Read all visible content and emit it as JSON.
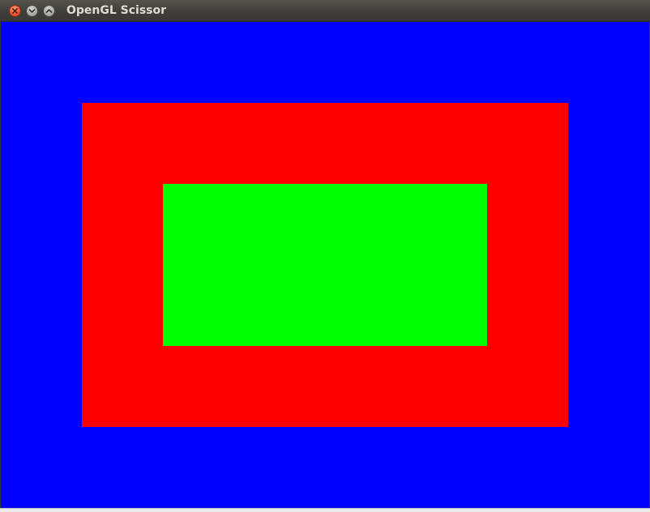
{
  "window": {
    "title": "OpenGL Scissor",
    "controls": {
      "close_icon": "close-icon",
      "minimize_icon": "chevron-down-icon",
      "maximize_icon": "chevron-up-icon"
    }
  },
  "scene": {
    "layers": [
      {
        "name": "outer-clear",
        "color": "#0000ff"
      },
      {
        "name": "middle-scissor",
        "color": "#ff0000"
      },
      {
        "name": "inner-scissor",
        "color": "#00ff00"
      }
    ]
  }
}
